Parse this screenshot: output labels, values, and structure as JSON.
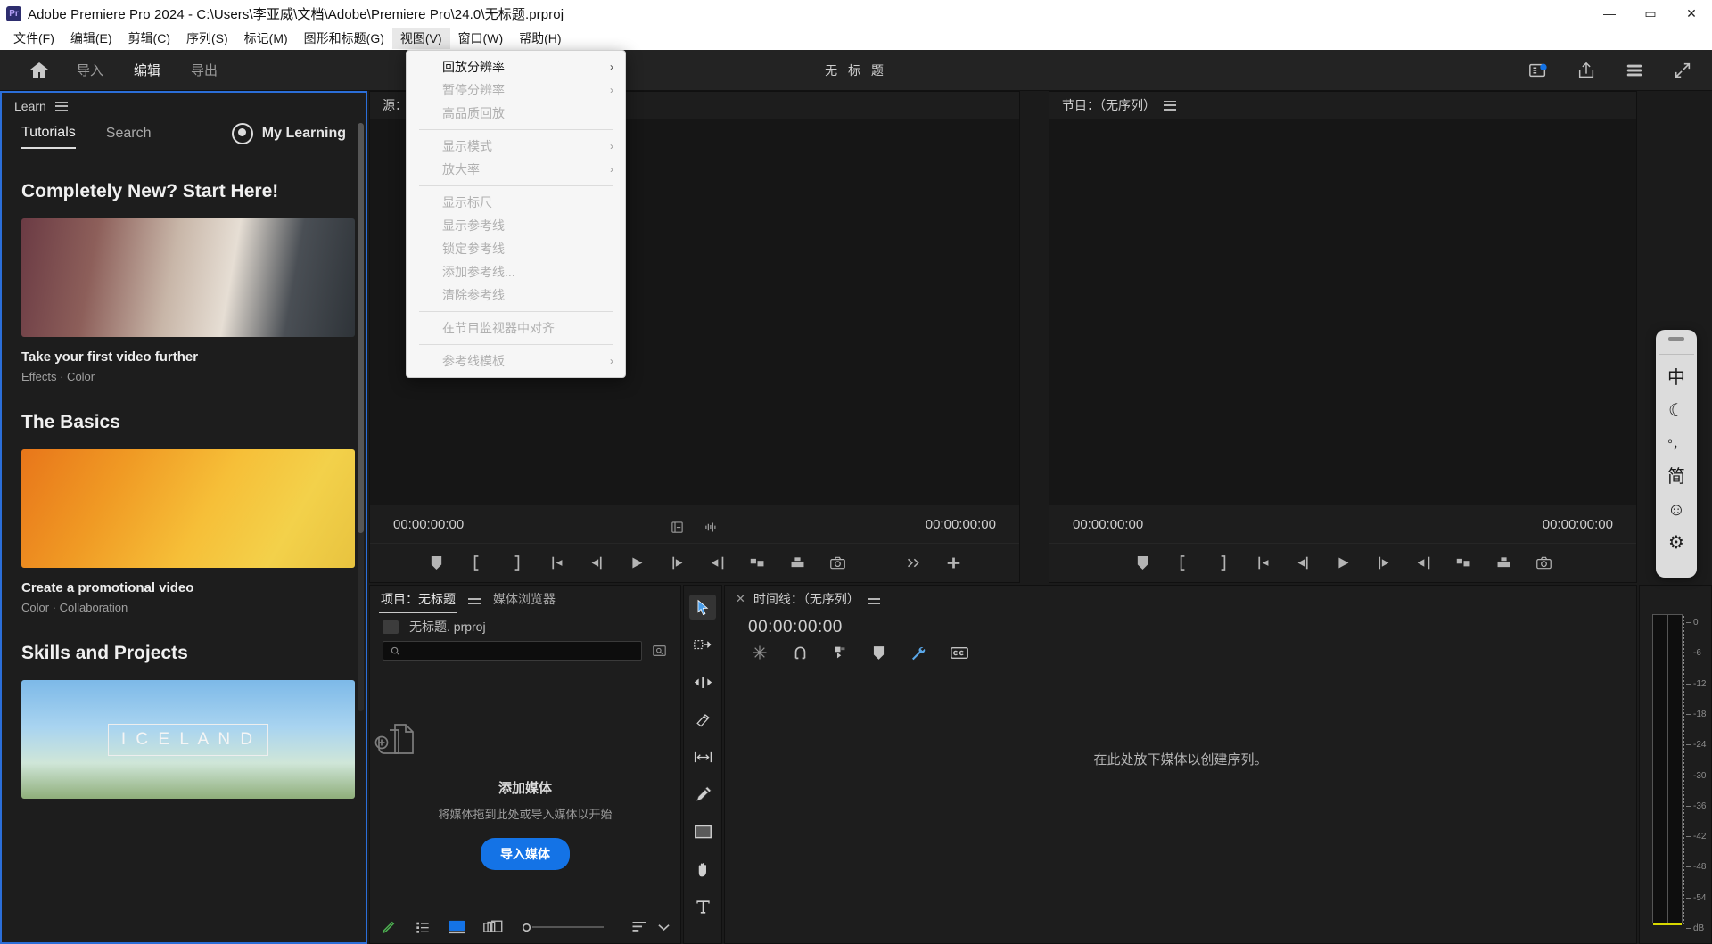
{
  "window": {
    "title": "Adobe Premiere Pro 2024 - C:\\Users\\李亚威\\文档\\Adobe\\Premiere Pro\\24.0\\无标题.prproj",
    "logo_text": "Pr",
    "minimize": "—",
    "maximize": "▭",
    "close": "✕"
  },
  "menubar": {
    "items": [
      {
        "label": "文件(F)",
        "active": false
      },
      {
        "label": "编辑(E)",
        "active": false
      },
      {
        "label": "剪辑(C)",
        "active": false
      },
      {
        "label": "序列(S)",
        "active": false
      },
      {
        "label": "标记(M)",
        "active": false
      },
      {
        "label": "图形和标题(G)",
        "active": false
      },
      {
        "label": "视图(V)",
        "active": true
      },
      {
        "label": "窗口(W)",
        "active": false
      },
      {
        "label": "帮助(H)",
        "active": false
      }
    ]
  },
  "dropdown": {
    "owner": "视图(V)",
    "items": [
      {
        "label": "回放分辨率",
        "enabled": true,
        "submenu": true,
        "sep_after": false
      },
      {
        "label": "暂停分辨率",
        "enabled": false,
        "submenu": true,
        "sep_after": false
      },
      {
        "label": "高品质回放",
        "enabled": false,
        "submenu": false,
        "sep_after": true
      },
      {
        "label": "显示模式",
        "enabled": false,
        "submenu": true,
        "sep_after": false
      },
      {
        "label": "放大率",
        "enabled": false,
        "submenu": true,
        "sep_after": true
      },
      {
        "label": "显示标尺",
        "enabled": false,
        "submenu": false,
        "sep_after": false
      },
      {
        "label": "显示参考线",
        "enabled": false,
        "submenu": false,
        "sep_after": false
      },
      {
        "label": "锁定参考线",
        "enabled": false,
        "submenu": false,
        "sep_after": false
      },
      {
        "label": "添加参考线...",
        "enabled": false,
        "submenu": false,
        "sep_after": false
      },
      {
        "label": "清除参考线",
        "enabled": false,
        "submenu": false,
        "sep_after": true
      },
      {
        "label": "在节目监视器中对齐",
        "enabled": false,
        "submenu": false,
        "sep_after": true
      },
      {
        "label": "参考线模板",
        "enabled": false,
        "submenu": true,
        "sep_after": false
      }
    ],
    "submenu_arrow": "›"
  },
  "apptoolbar": {
    "home_icon": "home-icon",
    "tabs": [
      {
        "label": "导入",
        "selected": false
      },
      {
        "label": "编辑",
        "selected": true
      },
      {
        "label": "导出",
        "selected": false
      }
    ],
    "center_title": "无 标 题",
    "right_icons": [
      "progress-badge-icon",
      "share-icon",
      "fullscreen-quickexport-icon",
      "expand-arrows-icon"
    ]
  },
  "learn": {
    "panel_title": "Learn",
    "menu_icon": "hamburger-icon",
    "tabs": [
      {
        "label": "Tutorials",
        "selected": true
      },
      {
        "label": "Search",
        "selected": false
      }
    ],
    "my_learning": "My Learning",
    "avatar_icon": "user-avatar-icon",
    "sections": [
      {
        "heading": "Completely New? Start Here!",
        "card_title": "Take your first video further",
        "card_tags": "Effects  ·  Color"
      },
      {
        "heading": "The Basics",
        "card_title": "Create a promotional video",
        "card_tags": "Color  ·  Collaboration"
      },
      {
        "heading": "Skills and Projects",
        "card_title": "",
        "card_tags": ""
      }
    ],
    "third_card_caption": "I C E L A N D"
  },
  "source_monitor": {
    "title": "源：",
    "menu_icon": "hamburger-icon",
    "timecode_left": "00:00:00:00",
    "timecode_right": "00:00:00:00",
    "mid_icons": [
      "settings-panel-icon",
      "audio-waveform-icon"
    ],
    "transport": [
      "add-marker-icon",
      "mark-in-icon",
      "mark-out-icon",
      "go-to-in-icon",
      "step-back-icon",
      "play-icon",
      "step-forward-icon",
      "go-to-out-icon",
      "insert-icon",
      "overwrite-icon",
      "export-frame-icon"
    ],
    "overflow_icon": "chevron-double-right-icon",
    "add_button_icon": "plus-icon"
  },
  "program_monitor": {
    "title": "节目：（无序列）",
    "menu_icon": "hamburger-icon",
    "timecode_left": "00:00:00:00",
    "timecode_right": "00:00:00:00",
    "transport": [
      "add-marker-icon",
      "mark-in-icon",
      "mark-out-icon",
      "go-to-in-icon",
      "step-back-icon",
      "play-icon",
      "step-forward-icon",
      "go-to-out-icon",
      "lift-icon",
      "extract-icon",
      "export-frame-icon"
    ]
  },
  "project_panel": {
    "tabs": [
      {
        "label": "项目：无标题",
        "selected": true,
        "menu_icon": "hamburger-icon"
      },
      {
        "label": "媒体浏览器",
        "selected": false
      }
    ],
    "file_name": "无标题. prproj",
    "file_icon": "project-file-icon",
    "search_placeholder": "",
    "search_value": "",
    "search_icon": "search-icon",
    "filter_icon": "search-filter-icon",
    "empty_icon": "add-media-icon",
    "empty_title": "添加媒体",
    "empty_subtitle": "将媒体拖到此处或导入媒体以开始",
    "import_button": "导入媒体",
    "accent_color": "#1473e6",
    "bottom_icons": [
      "freeform-view-icon",
      "list-view-icon",
      "icon-view-icon",
      "thumbnail-stack-icon",
      "zoom-slider-icon",
      "sort-icon",
      "chevron-down-icon"
    ]
  },
  "tools_panel": {
    "tools": [
      {
        "name": "selection-tool-icon",
        "selected": true
      },
      {
        "name": "track-select-forward-tool-icon",
        "selected": false
      },
      {
        "name": "ripple-edit-tool-icon",
        "selected": false
      },
      {
        "name": "razor-tool-icon",
        "selected": false
      },
      {
        "name": "slip-tool-icon",
        "selected": false
      },
      {
        "name": "pen-tool-icon",
        "selected": false
      },
      {
        "name": "rectangle-tool-icon",
        "selected": false
      },
      {
        "name": "hand-tool-icon",
        "selected": false
      },
      {
        "name": "type-tool-icon",
        "selected": false
      }
    ]
  },
  "timeline": {
    "close_icon": "close-icon",
    "title": "时间线：（无序列）",
    "menu_icon": "hamburger-icon",
    "timecode": "00:00:00:00",
    "tool_icons": [
      "nest-sequence-icon",
      "snap-icon",
      "linked-selection-icon",
      "add-marker-icon",
      "timeline-settings-icon",
      "captions-icon"
    ],
    "drop_hint": "在此处放下媒体以创建序列。"
  },
  "audio_meters": {
    "labels": [
      "0",
      "-6",
      "-12",
      "-18",
      "-24",
      "-30",
      "-36",
      "-42",
      "-48",
      "-54",
      "dB"
    ],
    "unit": "dB"
  },
  "ime_toolbar": {
    "items": [
      {
        "name": "ime-chinese-mode-icon",
        "glyph": "中"
      },
      {
        "name": "ime-night-mode-icon",
        "glyph": "☾"
      },
      {
        "name": "ime-punctuation-icon",
        "glyph": "°，"
      },
      {
        "name": "ime-simplified-icon",
        "glyph": "简"
      },
      {
        "name": "ime-emoji-icon",
        "glyph": "☺"
      },
      {
        "name": "ime-settings-icon",
        "glyph": "⚙"
      }
    ]
  }
}
